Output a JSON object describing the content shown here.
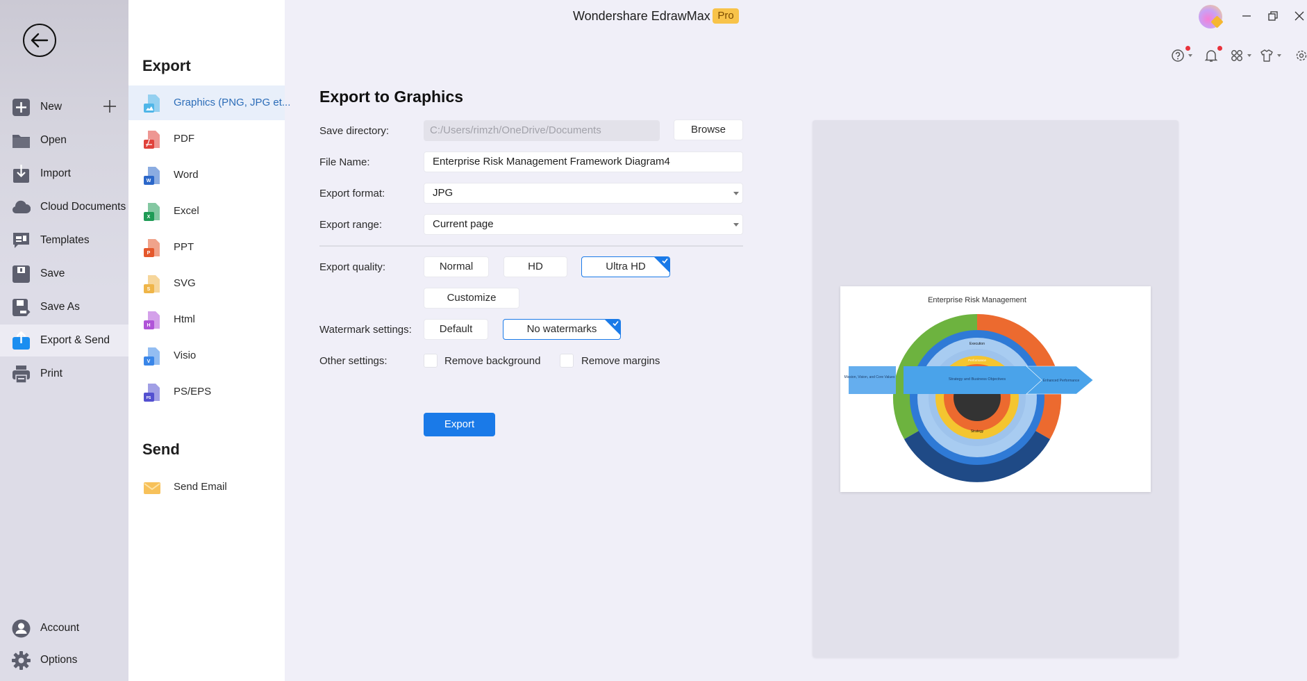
{
  "window": {
    "title": "Wondershare EdrawMax",
    "badge": "Pro",
    "controls": [
      "minimize",
      "restore",
      "close"
    ]
  },
  "toolbar": {
    "icons": [
      "help-icon",
      "notification-icon",
      "apps-icon",
      "theme-icon",
      "settings-icon"
    ]
  },
  "nav": {
    "back_label": "Back",
    "items": [
      {
        "label": "New",
        "icon": "new-icon"
      },
      {
        "label": "Open",
        "icon": "folder-icon"
      },
      {
        "label": "Import",
        "icon": "import-icon"
      },
      {
        "label": "Cloud Documents",
        "icon": "cloud-icon"
      },
      {
        "label": "Templates",
        "icon": "templates-icon"
      },
      {
        "label": "Save",
        "icon": "save-icon"
      },
      {
        "label": "Save As",
        "icon": "save-as-icon"
      },
      {
        "label": "Export & Send",
        "icon": "export-icon",
        "active": true
      },
      {
        "label": "Print",
        "icon": "print-icon"
      }
    ],
    "bottom": [
      {
        "label": "Account",
        "icon": "account-icon"
      },
      {
        "label": "Options",
        "icon": "gear-icon"
      }
    ]
  },
  "export_panel": {
    "export_heading": "Export",
    "export_items": [
      {
        "label": "Graphics (PNG, JPG et...",
        "color": "#4fb6e8",
        "letter": "",
        "active": true
      },
      {
        "label": "PDF",
        "color": "#e0423b",
        "letter": ""
      },
      {
        "label": "Word",
        "color": "#2b67c9",
        "letter": "W"
      },
      {
        "label": "Excel",
        "color": "#1f9b55",
        "letter": "X"
      },
      {
        "label": "PPT",
        "color": "#e4582c",
        "letter": "P"
      },
      {
        "label": "SVG",
        "color": "#efb548",
        "letter": "S"
      },
      {
        "label": "Html",
        "color": "#b054d8",
        "letter": "H"
      },
      {
        "label": "Visio",
        "color": "#3a86e8",
        "letter": "V"
      },
      {
        "label": "PS/EPS",
        "color": "#5350d0",
        "letter": "PS"
      }
    ],
    "send_heading": "Send",
    "send_items": [
      {
        "label": "Send Email",
        "color": "#f7c15a"
      }
    ]
  },
  "form": {
    "title": "Export to Graphics",
    "save_directory": {
      "label": "Save directory:",
      "value": "C:/Users/rimzh/OneDrive/Documents",
      "browse": "Browse"
    },
    "file_name": {
      "label": "File Name:",
      "value": "Enterprise Risk Management Framework Diagram4"
    },
    "export_format": {
      "label": "Export format:",
      "value": "JPG"
    },
    "export_range": {
      "label": "Export range:",
      "value": "Current page"
    },
    "export_quality": {
      "label": "Export quality:",
      "options": [
        "Normal",
        "HD",
        "Ultra HD"
      ],
      "selected": "Ultra HD",
      "customize": "Customize"
    },
    "watermark": {
      "label": "Watermark settings:",
      "options": [
        "Default",
        "No watermarks"
      ],
      "selected": "No watermarks"
    },
    "other": {
      "label": "Other settings:",
      "remove_background": {
        "label": "Remove background",
        "checked": false
      },
      "remove_margins": {
        "label": "Remove margins",
        "checked": false
      }
    },
    "export_button": "Export"
  },
  "preview": {
    "diagram_title": "Enterprise Risk Management",
    "left_arrow": "Mission, Vision, and Core Values",
    "center_band": "Strategy and Business Objectives",
    "right_arrow": "Enhanced Performance",
    "ring_labels": [
      "Execution",
      "Strategy",
      "Performance"
    ],
    "colors": {
      "green": "#6db33f",
      "orange": "#ec6a2f",
      "navy": "#1f4a86",
      "blue": "#2f7ad6",
      "light_blue": "#a8ccf1",
      "yellow": "#f4c530",
      "dark": "#333333",
      "band": "#4aa3ea"
    }
  },
  "colors": {
    "accent": "#1a7ae8",
    "nav_bg": "#dddce7",
    "main_bg": "#f0eff8",
    "pro_badge": "#f8c34a"
  }
}
